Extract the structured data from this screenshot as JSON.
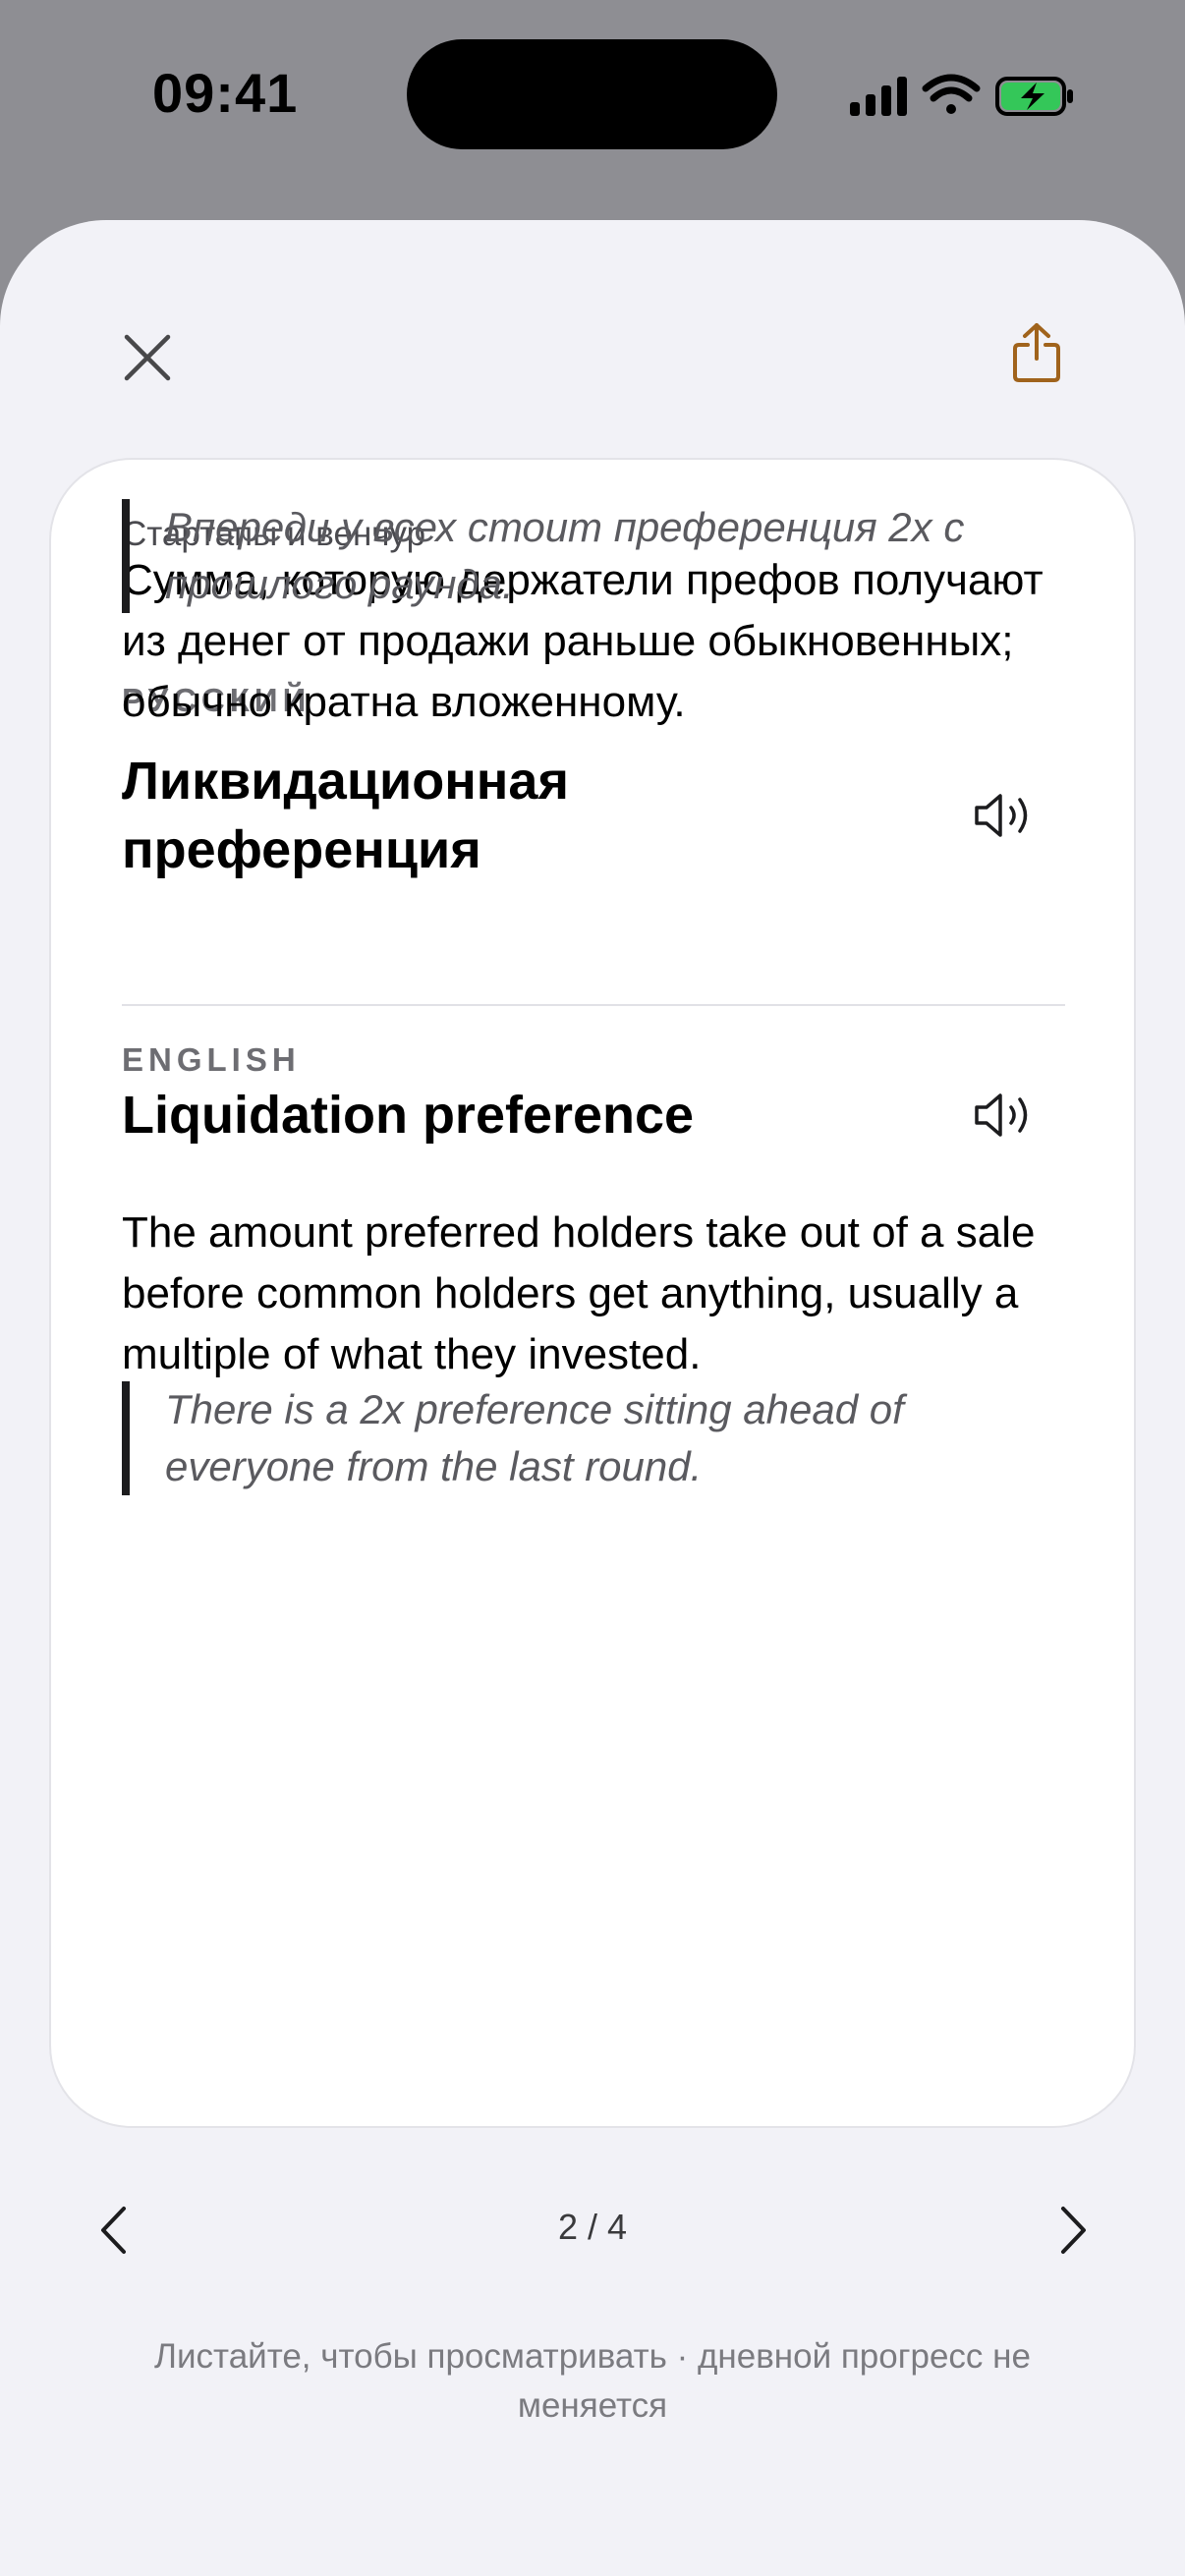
{
  "status_bar": {
    "time": "09:41",
    "icons": [
      "cellular-signal-icon",
      "wifi-icon",
      "battery-charging-icon"
    ],
    "battery_color": "#34c759"
  },
  "toolbar": {
    "close_icon": "close-icon",
    "share_icon": "share-icon",
    "accent_color": "#a0631c"
  },
  "card": {
    "category": "Стартапы и венчур",
    "russian": {
      "label": "РУССКИЙ",
      "term_line1": "Ликвидационная",
      "term_line2": "преференция",
      "definition": "Сумма, которую держатели префов получают из денег от продажи раньше обыкновенных; обычно кратна вложенному.",
      "example": "Впереди у всех стоит преференция 2х с прошлого раунда."
    },
    "english": {
      "label": "ENGLISH",
      "term": "Liquidation preference",
      "definition": "The amount preferred holders take out of a sale before common holders get anything, usually a multiple of what they invested.",
      "example": "There is a 2x preference sitting ahead of everyone from the last round."
    }
  },
  "pager": {
    "indicator": "2 / 4",
    "current": 2,
    "total": 4
  },
  "hint": "Листайте, чтобы просматривать · дневной прогресс не меняется"
}
